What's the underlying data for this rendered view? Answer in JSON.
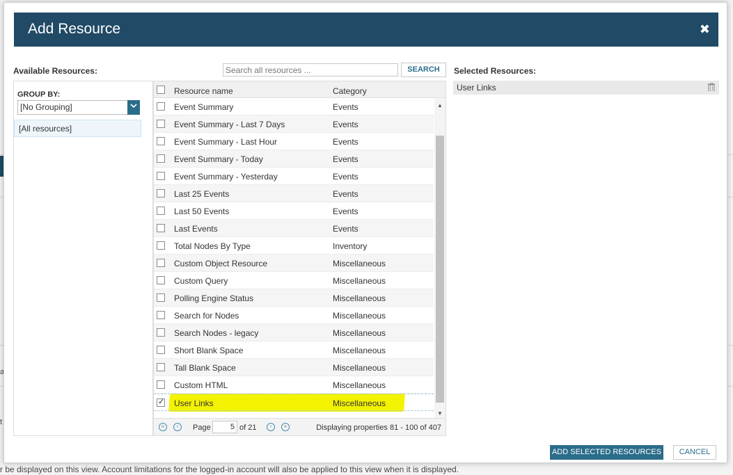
{
  "modal": {
    "title": "Add Resource",
    "close": "✖"
  },
  "available_label": "Available Resources:",
  "selected_label": "Selected Resources:",
  "search": {
    "placeholder": "Search all resources ...",
    "button": "SEARCH"
  },
  "group_by": {
    "label": "GROUP BY:",
    "value": "[No Grouping]",
    "items": [
      "[All resources]"
    ]
  },
  "table": {
    "headers": {
      "name": "Resource name",
      "category": "Category"
    },
    "rows": [
      {
        "name": "Event Summary",
        "category": "Events",
        "checked": false
      },
      {
        "name": "Event Summary - Last 7 Days",
        "category": "Events",
        "checked": false
      },
      {
        "name": "Event Summary - Last Hour",
        "category": "Events",
        "checked": false
      },
      {
        "name": "Event Summary - Today",
        "category": "Events",
        "checked": false
      },
      {
        "name": "Event Summary - Yesterday",
        "category": "Events",
        "checked": false
      },
      {
        "name": "Last 25 Events",
        "category": "Events",
        "checked": false
      },
      {
        "name": "Last 50 Events",
        "category": "Events",
        "checked": false
      },
      {
        "name": "Last Events",
        "category": "Events",
        "checked": false
      },
      {
        "name": "Total Nodes By Type",
        "category": "Inventory",
        "checked": false
      },
      {
        "name": "Custom Object Resource",
        "category": "Miscellaneous",
        "checked": false
      },
      {
        "name": "Custom Query",
        "category": "Miscellaneous",
        "checked": false
      },
      {
        "name": "Polling Engine Status",
        "category": "Miscellaneous",
        "checked": false
      },
      {
        "name": "Search for Nodes",
        "category": "Miscellaneous",
        "checked": false
      },
      {
        "name": "Search Nodes - legacy",
        "category": "Miscellaneous",
        "checked": false
      },
      {
        "name": "Short Blank Space",
        "category": "Miscellaneous",
        "checked": false
      },
      {
        "name": "Tall Blank Space",
        "category": "Miscellaneous",
        "checked": false
      },
      {
        "name": "Custom HTML",
        "category": "Miscellaneous",
        "checked": false
      },
      {
        "name": "User Links",
        "category": "Miscellaneous",
        "checked": true
      }
    ]
  },
  "pager": {
    "page_label": "Page",
    "page_value": "5",
    "of_label": "of 21",
    "display": "Displaying properties 81 - 100 of 407"
  },
  "selected": {
    "items": [
      "User Links"
    ]
  },
  "buttons": {
    "add": "ADD SELECTED RESOURCES",
    "cancel": "CANCEL"
  },
  "background": {
    "footer_text": "r be displayed on this view. Account limitations for the logged-in account will also be applied to this view when it is displayed.",
    "frag_a": "a",
    "frag_t": "t"
  },
  "colors": {
    "header": "#204a65",
    "accent": "#2a6d8a",
    "highlight": "#f3f200"
  }
}
